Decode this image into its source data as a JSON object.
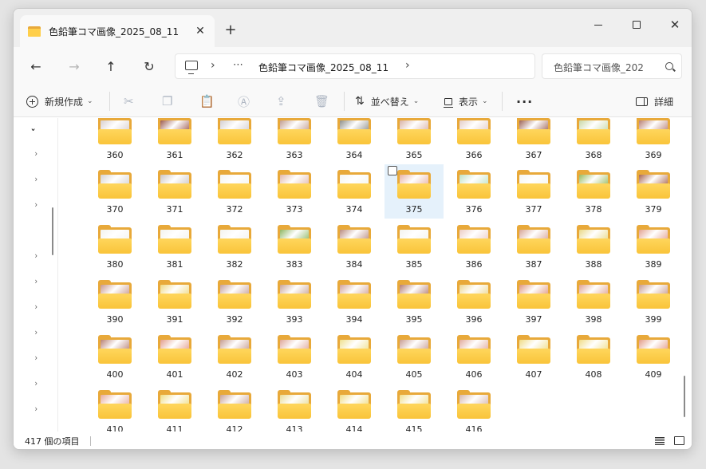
{
  "window": {
    "tab_title": "色鉛筆コマ画像_2025_08_11",
    "tab_close": "✕",
    "new_tab": "+",
    "minimize": "minimize",
    "maximize": "maximize",
    "close": "✕"
  },
  "nav": {
    "back": "←",
    "forward": "→",
    "up": "↑",
    "refresh": "↻",
    "more": "⋯",
    "chevron": "›",
    "path": "色鉛筆コマ画像_2025_08_11",
    "search_placeholder": "色鉛筆コマ画像_202"
  },
  "commands": {
    "new_label": "新規作成",
    "cut": "✂",
    "copy": "❐",
    "paste": "📋",
    "rename": "Ⓐ",
    "share": "⇪",
    "delete": "🗑",
    "sort_label": "並べ替え",
    "view_label": "表示",
    "more": "···",
    "details_label": "詳細",
    "caret": "⌄"
  },
  "navpane": {
    "expanded": "⌄",
    "collapsed": "›"
  },
  "folders": [
    {
      "name": "360",
      "paper": "#d9d0cf"
    },
    {
      "name": "361",
      "paper": "#9c5a4e"
    },
    {
      "name": "362",
      "paper": "#d4cfd1"
    },
    {
      "name": "363",
      "paper": "#c29e90"
    },
    {
      "name": "364",
      "paper": "#8f8f89"
    },
    {
      "name": "365",
      "paper": "#d9b3a6"
    },
    {
      "name": "366",
      "paper": "#e4cdc6"
    },
    {
      "name": "367",
      "paper": "#9d6355"
    },
    {
      "name": "368",
      "paper": "#c9d8a6"
    },
    {
      "name": "369",
      "paper": "#b98175"
    },
    {
      "name": "370",
      "paper": "#d6d3d2"
    },
    {
      "name": "371",
      "paper": "#cdc6c4"
    },
    {
      "name": "372",
      "paper": "#f5f5f0"
    },
    {
      "name": "373",
      "paper": "#e2b9ad"
    },
    {
      "name": "374",
      "paper": "#f5f5f0"
    },
    {
      "name": "375",
      "paper": "#e8b3a5"
    },
    {
      "name": "376",
      "paper": "#bfe2c3"
    },
    {
      "name": "377",
      "paper": "#f5f5f0"
    },
    {
      "name": "378",
      "paper": "#98ba5e"
    },
    {
      "name": "379",
      "paper": "#a8644f"
    },
    {
      "name": "380",
      "paper": "#f3f3ee"
    },
    {
      "name": "381",
      "paper": "#f3f3ee"
    },
    {
      "name": "382",
      "paper": "#f3f3ee"
    },
    {
      "name": "383",
      "paper": "#8fb763"
    },
    {
      "name": "384",
      "paper": "#b98b80"
    },
    {
      "name": "385",
      "paper": "#f3f3ee"
    },
    {
      "name": "386",
      "paper": "#eccdc5"
    },
    {
      "name": "387",
      "paper": "#d8a596"
    },
    {
      "name": "388",
      "paper": "#e9d986"
    },
    {
      "name": "389",
      "paper": "#e3a291"
    },
    {
      "name": "390",
      "paper": "#c9988c"
    },
    {
      "name": "391",
      "paper": "#efd982"
    },
    {
      "name": "392",
      "paper": "#c6a09a"
    },
    {
      "name": "393",
      "paper": "#c9a497"
    },
    {
      "name": "394",
      "paper": "#d2a398"
    },
    {
      "name": "395",
      "paper": "#b47c72"
    },
    {
      "name": "396",
      "paper": "#ecd68f"
    },
    {
      "name": "397",
      "paper": "#e0967f"
    },
    {
      "name": "398",
      "paper": "#e0a392"
    },
    {
      "name": "399",
      "paper": "#c89a8e"
    },
    {
      "name": "400",
      "paper": "#b88174"
    },
    {
      "name": "401",
      "paper": "#e39d8c"
    },
    {
      "name": "402",
      "paper": "#c69c90"
    },
    {
      "name": "403",
      "paper": "#dfa799"
    },
    {
      "name": "404",
      "paper": "#efe08e"
    },
    {
      "name": "405",
      "paper": "#c89d92"
    },
    {
      "name": "406",
      "paper": "#e2ab9c"
    },
    {
      "name": "407",
      "paper": "#f0dc85"
    },
    {
      "name": "408",
      "paper": "#f1dd88"
    },
    {
      "name": "409",
      "paper": "#e39b87"
    },
    {
      "name": "410",
      "paper": "#e7ab9c"
    },
    {
      "name": "411",
      "paper": "#efdd83"
    },
    {
      "name": "412",
      "paper": "#c9a398"
    },
    {
      "name": "413",
      "paper": "#e9dc97"
    },
    {
      "name": "414",
      "paper": "#f0dc83"
    },
    {
      "name": "415",
      "paper": "#f0de8c"
    },
    {
      "name": "416",
      "paper": "#d7b7ae"
    }
  ],
  "selected_folder": "375",
  "status": {
    "item_count": "417 個の項目"
  },
  "colors": {
    "accent": "#e5f1fb",
    "folder_back": "#e8a93a",
    "folder_front": "#ffcf4a"
  }
}
